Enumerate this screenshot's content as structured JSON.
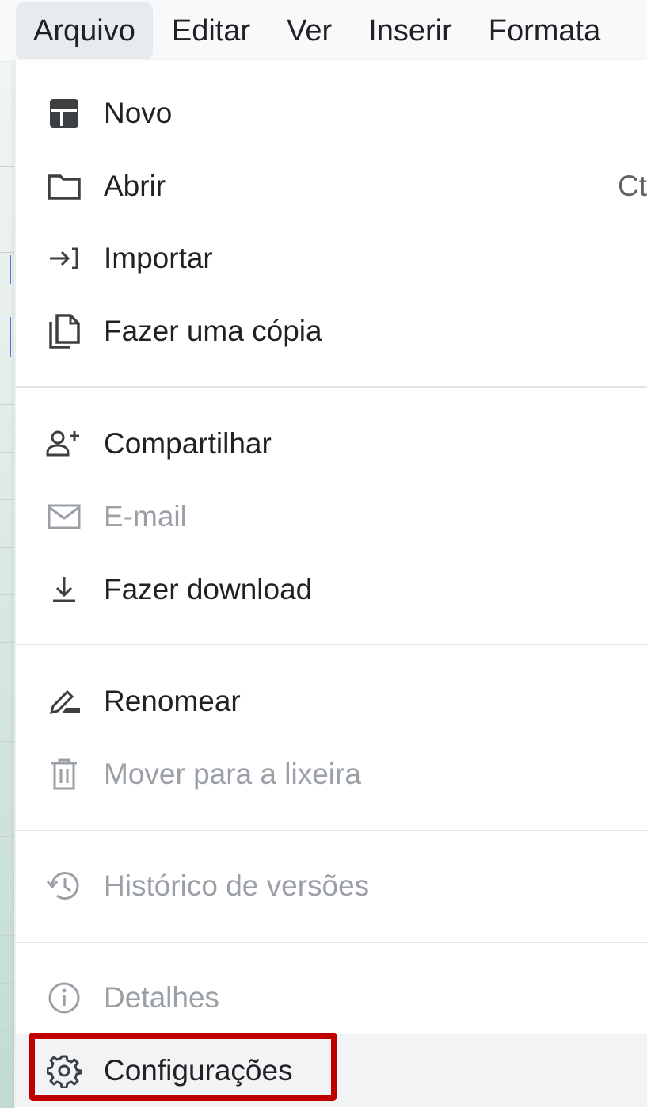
{
  "menubar": {
    "items": [
      "Arquivo",
      "Editar",
      "Ver",
      "Inserir",
      "Formata"
    ],
    "active_index": 0
  },
  "file_menu": {
    "items": [
      {
        "label": "Novo",
        "icon": "new-doc-icon",
        "enabled": true
      },
      {
        "label": "Abrir",
        "icon": "folder-icon",
        "enabled": true,
        "shortcut": "Ct"
      },
      {
        "label": "Importar",
        "icon": "import-icon",
        "enabled": true
      },
      {
        "label": "Fazer uma cópia",
        "icon": "copy-icon",
        "enabled": true
      },
      {
        "label": "Compartilhar",
        "icon": "share-person-add-icon",
        "enabled": true
      },
      {
        "label": "E-mail",
        "icon": "mail-icon",
        "enabled": false
      },
      {
        "label": "Fazer download",
        "icon": "download-icon",
        "enabled": true
      },
      {
        "label": "Renomear",
        "icon": "rename-pen-icon",
        "enabled": true
      },
      {
        "label": "Mover para a lixeira",
        "icon": "trash-icon",
        "enabled": false
      },
      {
        "label": "Histórico de versões",
        "icon": "history-icon",
        "enabled": false
      },
      {
        "label": "Detalhes",
        "icon": "info-icon",
        "enabled": false
      },
      {
        "label": "Configurações",
        "icon": "gear-icon",
        "enabled": true,
        "hovered": true
      }
    ]
  },
  "colors": {
    "text": "#202124",
    "disabled_text": "#9aa0a6",
    "hover_bg": "#f1f3f4",
    "annotation": "#c00000"
  }
}
